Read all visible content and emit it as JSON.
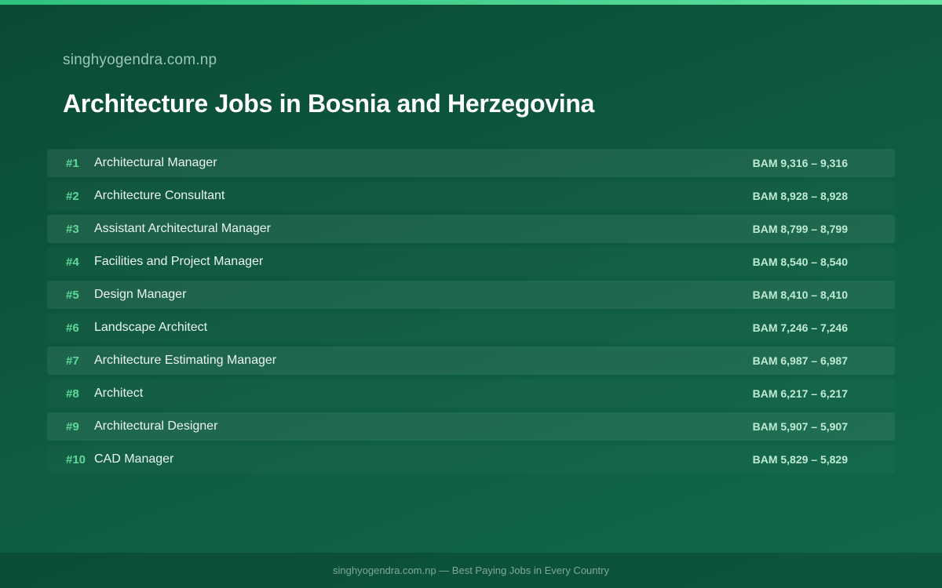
{
  "colors": {
    "background_start": "#0b4a35",
    "background_end": "#10694a",
    "accent": "#2ec27e",
    "rank_color": "#5ed99a"
  },
  "header": {
    "site": "singhyogendra.com.np",
    "title": "Architecture Jobs in Bosnia and Herzegovina"
  },
  "jobs": [
    {
      "rank": "#1",
      "title": "Architectural Manager",
      "salary": "BAM 9,316 – 9,316"
    },
    {
      "rank": "#2",
      "title": "Architecture Consultant",
      "salary": "BAM 8,928 – 8,928"
    },
    {
      "rank": "#3",
      "title": "Assistant Architectural Manager",
      "salary": "BAM 8,799 – 8,799"
    },
    {
      "rank": "#4",
      "title": "Facilities and Project Manager",
      "salary": "BAM 8,540 – 8,540"
    },
    {
      "rank": "#5",
      "title": "Design Manager",
      "salary": "BAM 8,410 – 8,410"
    },
    {
      "rank": "#6",
      "title": "Landscape Architect",
      "salary": "BAM 7,246 – 7,246"
    },
    {
      "rank": "#7",
      "title": "Architecture Estimating Manager",
      "salary": "BAM 6,987 – 6,987"
    },
    {
      "rank": "#8",
      "title": "Architect",
      "salary": "BAM 6,217 – 6,217"
    },
    {
      "rank": "#9",
      "title": "Architectural Designer",
      "salary": "BAM 5,907 – 5,907"
    },
    {
      "rank": "#10",
      "title": "CAD Manager",
      "salary": "BAM 5,829 – 5,829"
    }
  ],
  "footer": {
    "text": "singhyogendra.com.np — Best Paying Jobs in Every Country"
  }
}
